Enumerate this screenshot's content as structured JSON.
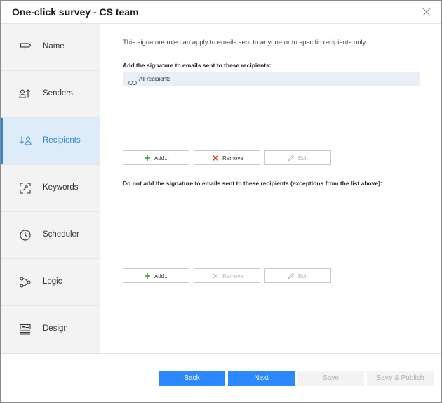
{
  "dialog": {
    "title": "One-click survey - CS team"
  },
  "sidebar": {
    "items": [
      {
        "label": "Name",
        "icon": "signpost-icon",
        "active": false
      },
      {
        "label": "Senders",
        "icon": "senders-icon",
        "active": false
      },
      {
        "label": "Recipients",
        "icon": "recipients-icon",
        "active": true
      },
      {
        "label": "Keywords",
        "icon": "keywords-icon",
        "active": false
      },
      {
        "label": "Scheduler",
        "icon": "clock-icon",
        "active": false
      },
      {
        "label": "Logic",
        "icon": "logic-icon",
        "active": false
      },
      {
        "label": "Design",
        "icon": "design-icon",
        "active": false
      }
    ]
  },
  "main": {
    "intro": "This signature rule can apply to emails sent to anyone or to specific recipients only.",
    "include": {
      "label": "Add the signature to emails sent to these recipients:",
      "items": [
        "All recipients"
      ],
      "buttons": {
        "add": "Add...",
        "remove": "Remove",
        "edit": "Edit"
      }
    },
    "exclude": {
      "label": "Do not add the signature to emails sent to these recipients (exceptions from the list above):",
      "items": [],
      "buttons": {
        "add": "Add...",
        "remove": "Remove",
        "edit": "Edit"
      }
    }
  },
  "footer": {
    "back": "Back",
    "next": "Next",
    "save": "Save",
    "save_publish": "Save & Publish"
  },
  "colors": {
    "accent": "#2b88ff",
    "active_bg": "#deecf9",
    "add_green": "#2e9e2e",
    "remove_red": "#d83b01"
  }
}
